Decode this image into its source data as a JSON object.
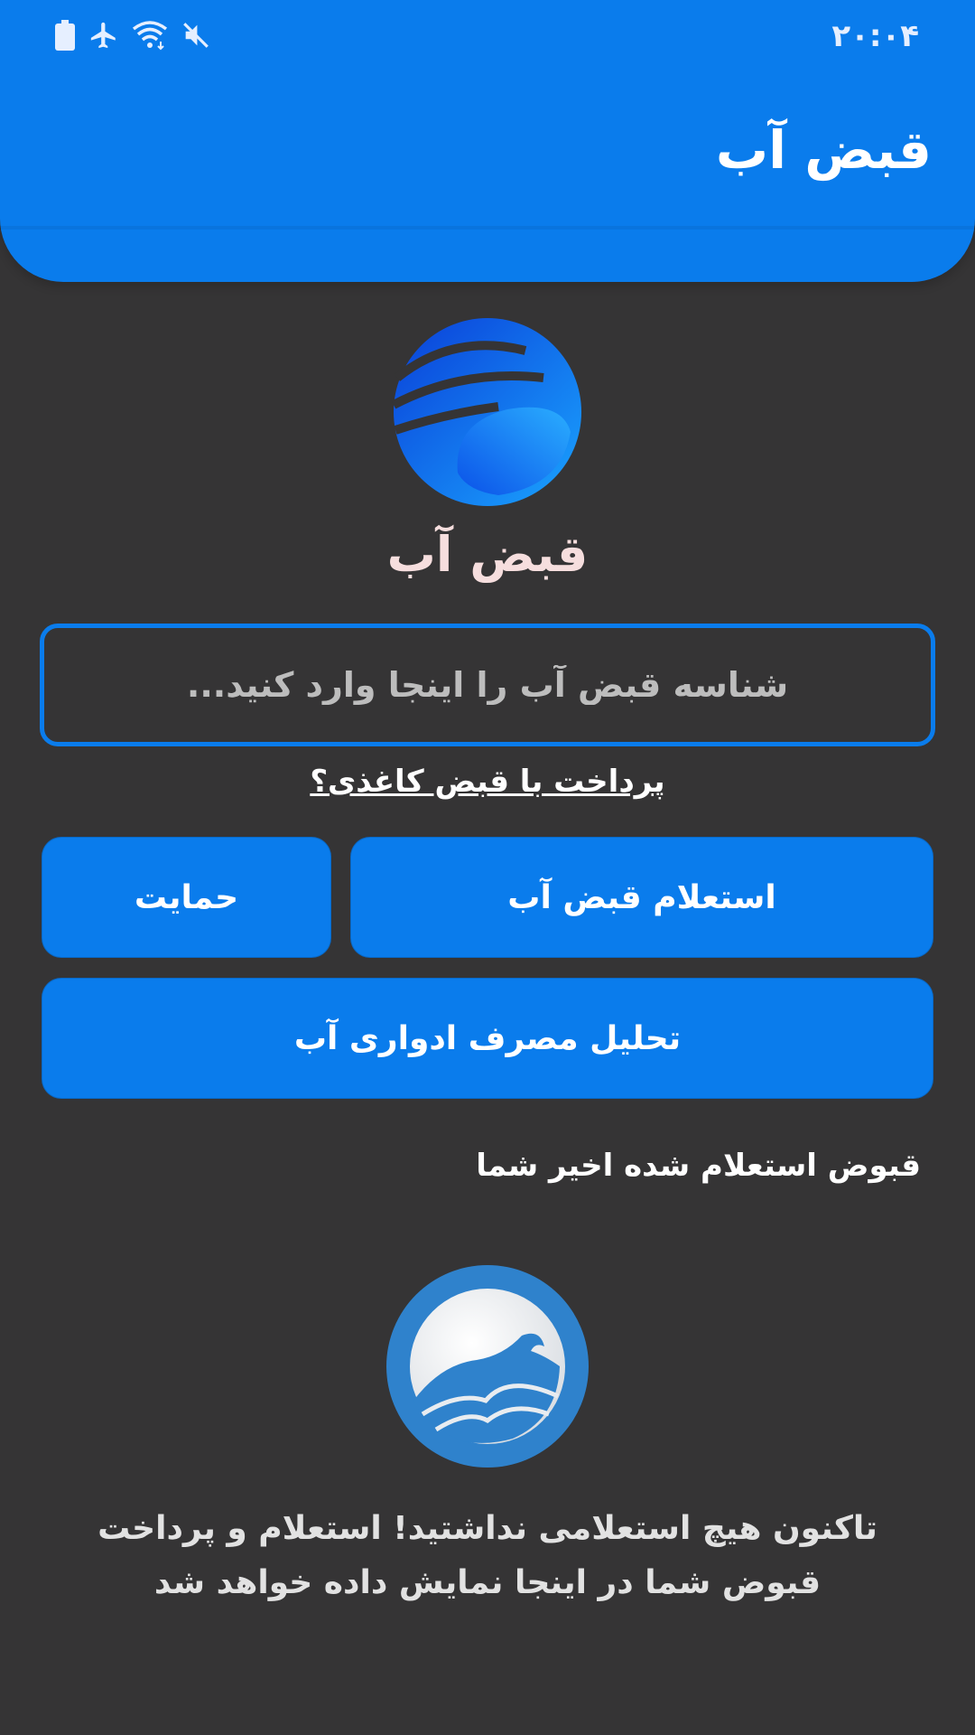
{
  "status_bar": {
    "time": "۲۰:۰۴",
    "icons": [
      "battery-icon",
      "airplane-icon",
      "wifi-icon",
      "mute-icon"
    ]
  },
  "header": {
    "title": "قبض آب"
  },
  "brand": {
    "name": "قبض آب"
  },
  "search": {
    "placeholder": "شناسه قبض آب را اینجا وارد کنید...",
    "value": ""
  },
  "paper_bill_link": "پرداخت با قبض کاغذی؟",
  "buttons": {
    "inquiry": "استعلام قبض آب",
    "support": "حمایت",
    "analysis": "تحلیل مصرف ادواری آب"
  },
  "recent": {
    "title": "قبوض استعلام شده اخیر شما",
    "empty_line1": "تاکنون هیچ استعلامی نداشتید! استعلام و پرداخت",
    "empty_line2": "قبوض شما در اینجا نمایش داده خواهد شد"
  },
  "colors": {
    "primary": "#0a7cec",
    "background": "#353435",
    "brand_text": "#f6dede"
  }
}
